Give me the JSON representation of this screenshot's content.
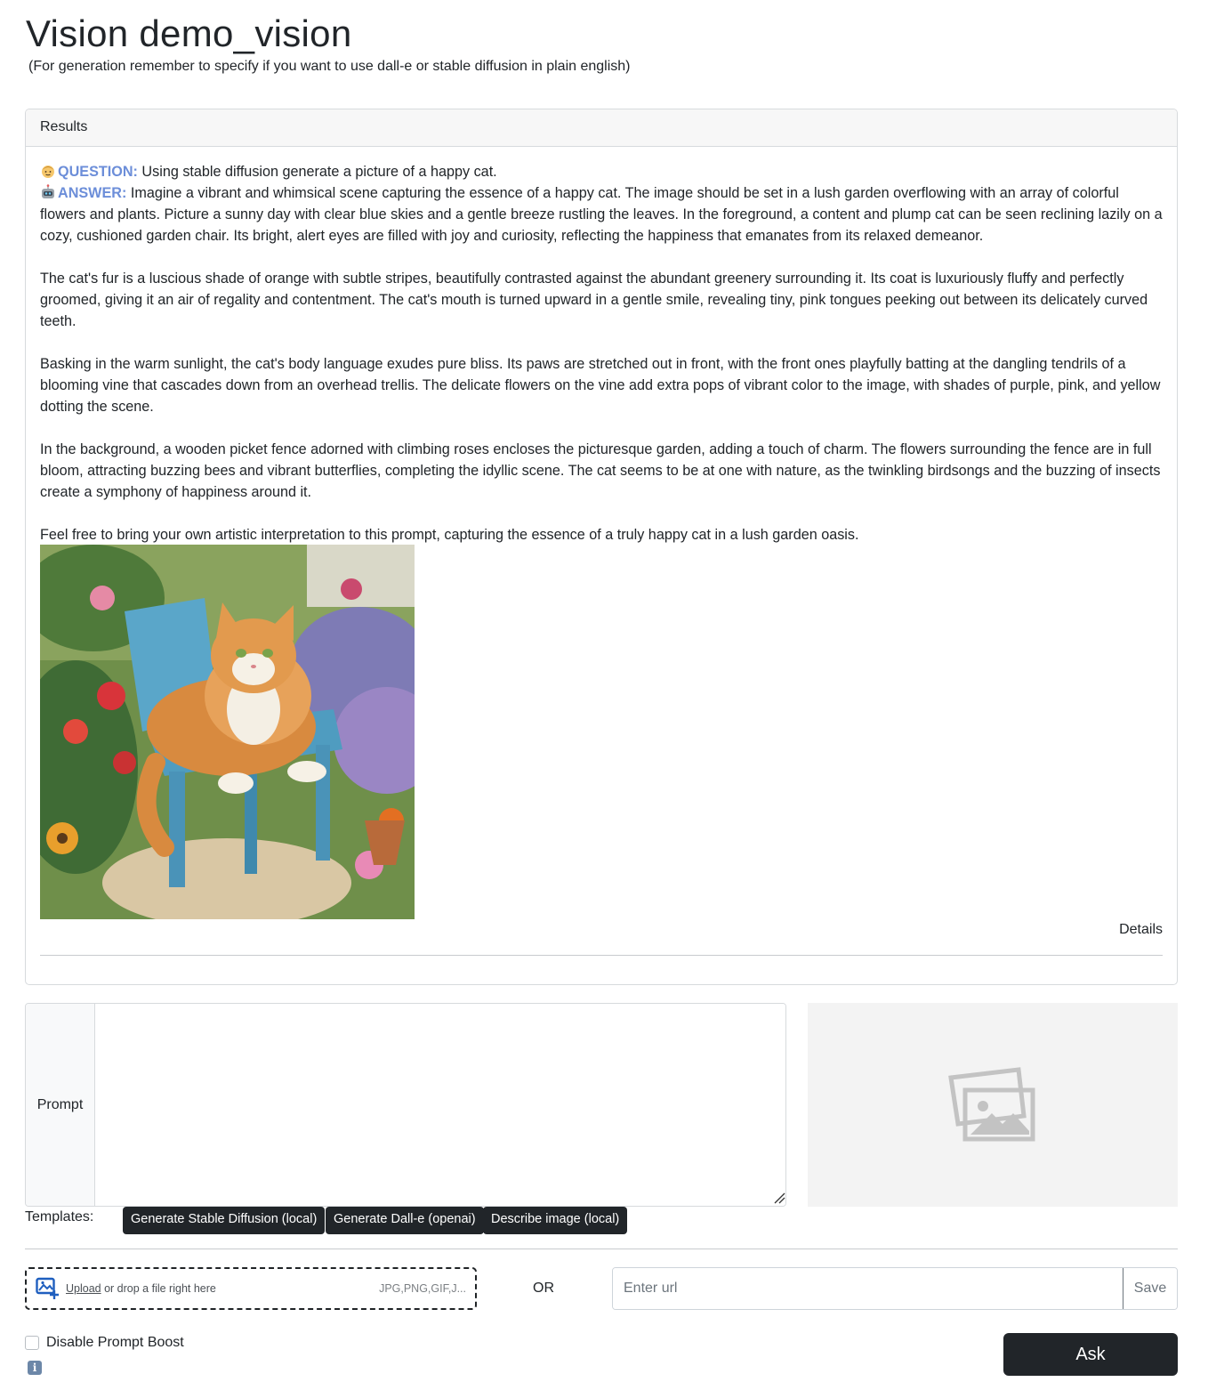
{
  "page": {
    "title": "Vision demo_vision",
    "subtitle": "(For generation remember to specify if you want to use dall-e or stable diffusion in plain english)"
  },
  "results": {
    "header": "Results",
    "question_label": "QUESTION:",
    "question_text": " Using stable diffusion generate a picture of a happy cat.",
    "answer_label": "ANSWER:",
    "answer_paragraphs": [
      " Imagine a vibrant and whimsical scene capturing the essence of a happy cat. The image should be set in a lush garden overflowing with an array of colorful flowers and plants. Picture a sunny day with clear blue skies and a gentle breeze rustling the leaves. In the foreground, a content and plump cat can be seen reclining lazily on a cozy, cushioned garden chair. Its bright, alert eyes are filled with joy and curiosity, reflecting the happiness that emanates from its relaxed demeanor.",
      "The cat's fur is a luscious shade of orange with subtle stripes, beautifully contrasted against the abundant greenery surrounding it. Its coat is luxuriously fluffy and perfectly groomed, giving it an air of regality and contentment. The cat's mouth is turned upward in a gentle smile, revealing tiny, pink tongues peeking out between its delicately curved teeth.",
      "Basking in the warm sunlight, the cat's body language exudes pure bliss. Its paws are stretched out in front, with the front ones playfully batting at the dangling tendrils of a blooming vine that cascades down from an overhead trellis. The delicate flowers on the vine add extra pops of vibrant color to the image, with shades of purple, pink, and yellow dotting the scene.",
      "In the background, a wooden picket fence adorned with climbing roses encloses the picturesque garden, adding a touch of charm. The flowers surrounding the fence are in full bloom, attracting buzzing bees and vibrant butterflies, completing the idyllic scene. The cat seems to be at one with nature, as the twinkling birdsongs and the buzzing of insects create a symphony of happiness around it.",
      "Feel free to bring your own artistic interpretation to this prompt, capturing the essence of a truly happy cat in a lush garden oasis."
    ],
    "details_label": "Details"
  },
  "prompt": {
    "label": "Prompt",
    "value": ""
  },
  "templates": {
    "label": "Templates:",
    "buttons": [
      "Generate Stable Diffusion (local)",
      "Generate Dall-e (openai)",
      "Describe image (local)"
    ]
  },
  "upload": {
    "link": "Upload",
    "text": " or drop a file right here",
    "types": "JPG,PNG,GIF,J..."
  },
  "or_label": "OR",
  "url": {
    "placeholder": "Enter url",
    "save_label": "Save"
  },
  "prompt_boost": {
    "label": "Disable Prompt Boost",
    "checked": false
  },
  "ask_label": "Ask",
  "icons": {
    "question": "person-emoji-icon",
    "answer": "robot-emoji-icon",
    "upload": "image-add-icon",
    "placeholder": "image-placeholder-icon",
    "info": "info-icon"
  },
  "colors": {
    "label_accent": "#6c8ed9",
    "dark_button": "#212529"
  }
}
